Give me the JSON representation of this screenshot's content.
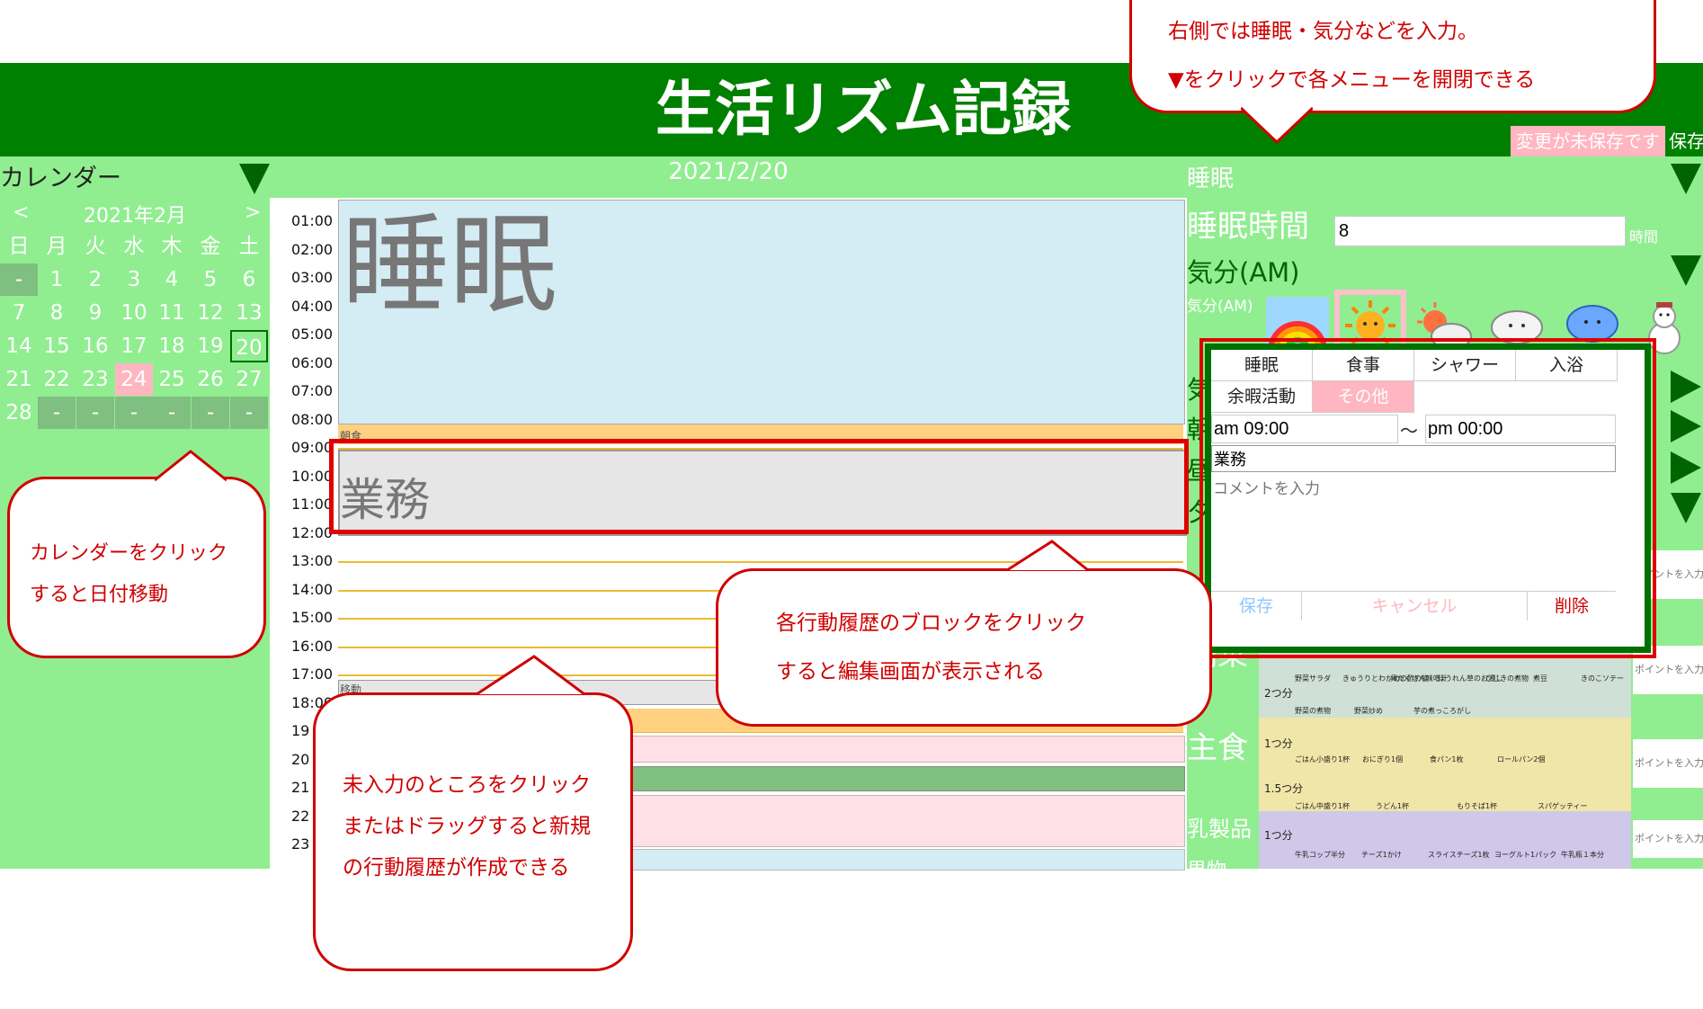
{
  "app": {
    "title": "生活リズム記録",
    "unsaved_badge": "変更が未保存です",
    "save_top": "保存"
  },
  "calendar": {
    "label": "カレンダー",
    "prev": "<",
    "next": ">",
    "month": "2021年2月",
    "weekdays": [
      "日",
      "月",
      "火",
      "水",
      "木",
      "金",
      "土"
    ],
    "rows": [
      [
        "-",
        "1",
        "2",
        "3",
        "4",
        "5",
        "6"
      ],
      [
        "7",
        "8",
        "9",
        "10",
        "11",
        "12",
        "13"
      ],
      [
        "14",
        "15",
        "16",
        "17",
        "18",
        "19",
        "20"
      ],
      [
        "21",
        "22",
        "23",
        "24",
        "25",
        "26",
        "27"
      ],
      [
        "28",
        "-",
        "-",
        "-",
        "-",
        "-",
        "-"
      ]
    ],
    "selected_day": "20",
    "today_day": "24"
  },
  "timeline": {
    "date": "2021/2/20",
    "hours": [
      "01:00",
      "02:00",
      "03:00",
      "04:00",
      "05:00",
      "06:00",
      "07:00",
      "08:00",
      "09:00",
      "10:00",
      "11:00",
      "12:00",
      "13:00",
      "14:00",
      "15:00",
      "16:00",
      "17:00",
      "18:00",
      "19",
      "20",
      "21",
      "22",
      "23"
    ],
    "blocks": {
      "sleep": "睡眠",
      "breakfast": "朝食",
      "work": "業務",
      "commute": "移動"
    }
  },
  "right": {
    "sleep_section": "睡眠",
    "sleep_time_label": "睡眠時間",
    "sleep_time_value": "8",
    "sleep_unit": "時間",
    "mood_am_section": "気分(AM)",
    "mood_am_small": "気分(AM)",
    "partial_labels": [
      "気",
      "朝",
      "昼",
      "夕"
    ],
    "food_labels": [
      "副菜",
      "主食",
      "乳製品",
      "果物"
    ],
    "point_placeholder": "ポイントを入力"
  },
  "dialog": {
    "tabs": [
      "睡眠",
      "食事",
      "シャワー",
      "入浴",
      "余暇活動",
      "その他"
    ],
    "start_time": "am 09:00",
    "tilde": "〜",
    "end_time": "pm 00:00",
    "activity_name": "業務",
    "comment_placeholder": "コメントを入力",
    "save": "保存",
    "cancel": "キャンセル",
    "delete": "削除"
  },
  "callouts": {
    "top_line1": "右側では睡眠・気分などを入力。",
    "top_line2": "▼をクリックで各メニューを開閉できる",
    "calendar_line1": "カレンダーをクリック",
    "calendar_line2": "すると日付移動",
    "block_line1": "各行動履歴のブロックをクリック",
    "block_line2": "すると編集画面が表示される",
    "empty_line1": "未入力のところをクリック",
    "empty_line2": "またはドラッグすると新規",
    "empty_line3": "の行動履歴が作成できる"
  },
  "food_chart": {
    "veg_1": [
      "野菜サラダ",
      "きゅうりとわかめの酢の物",
      "具たくさん味噌汁",
      "ほうれん草のお浸し",
      "ひじきの煮物",
      "煮豆",
      "きのこソテー"
    ],
    "veg_2": [
      "野菜の煮物",
      "野菜炒め",
      "芋の煮っころがし"
    ],
    "grain_1": [
      "ごはん小盛り1杯",
      "おにぎり1個",
      "食パン1枚",
      "ロールパン2個"
    ],
    "grain_2": [
      "ごはん中盛り1杯",
      "うどん1杯",
      "もりそば1杯",
      "スパゲッティー"
    ],
    "dairy": [
      "牛乳コップ半分",
      "チーズ1かけ",
      "スライスチーズ1枚",
      "ヨーグルト1パック",
      "牛乳瓶１本分"
    ],
    "serving_labels": [
      "1つ分",
      "2つ分",
      "1.5つ分"
    ]
  },
  "colors": {
    "header_green": "#008000",
    "panel_green": "#90ee90",
    "callout_red": "#d00000",
    "sleep_block": "#d4ecf4",
    "work_block": "#e6e6e6",
    "meal_block": "#ffd080",
    "pink_block": "#ffe0e6"
  }
}
